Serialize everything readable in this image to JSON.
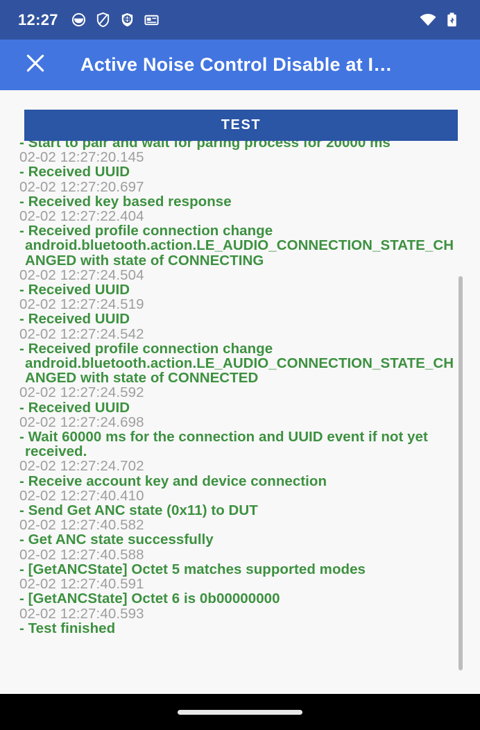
{
  "status_bar": {
    "time": "12:27",
    "left_icons": [
      "clock-outline-icon",
      "shield-slash-icon",
      "shield-globe-icon",
      "card-icon"
    ],
    "right_icons": [
      "wifi-icon",
      "battery-icon"
    ],
    "background_color": "#31539f"
  },
  "app_bar": {
    "close_icon": "close-icon",
    "title": "Active Noise Control Disable at I…",
    "background_color": "#4275e0"
  },
  "toolbar": {
    "test_label": "TEST",
    "test_color": "#2b55a5"
  },
  "colors": {
    "log_message": "#3d9140",
    "log_timestamp": "#9e9e9e",
    "content_background": "#f8f8f8",
    "scrollbar": "#bdbdbd"
  },
  "log": {
    "entries": [
      {
        "time": "",
        "message": "- Start to pair and wait for paring process for 20000 ms"
      },
      {
        "time": "02-02 12:27:20.145",
        "message": "- Received UUID"
      },
      {
        "time": "02-02 12:27:20.697",
        "message": "- Received key based response"
      },
      {
        "time": "02-02 12:27:22.404",
        "message": "- Received profile connection change android.bluetooth.action.LE_AUDIO_CONNECTION_STATE_CHANGED with state of CONNECTING"
      },
      {
        "time": "02-02 12:27:24.504",
        "message": "- Received UUID"
      },
      {
        "time": "02-02 12:27:24.519",
        "message": "- Received UUID"
      },
      {
        "time": "02-02 12:27:24.542",
        "message": "- Received profile connection change android.bluetooth.action.LE_AUDIO_CONNECTION_STATE_CHANGED with state of CONNECTED"
      },
      {
        "time": "02-02 12:27:24.592",
        "message": "- Received UUID"
      },
      {
        "time": "02-02 12:27:24.698",
        "message": "- Wait 60000 ms for the connection and UUID event if not yet received."
      },
      {
        "time": "02-02 12:27:24.702",
        "message": "- Receive account key and device connection"
      },
      {
        "time": "02-02 12:27:40.410",
        "message": "- Send Get ANC state (0x11) to DUT"
      },
      {
        "time": "02-02 12:27:40.582",
        "message": "- Get ANC state successfully"
      },
      {
        "time": "02-02 12:27:40.588",
        "message": "- [GetANCState] Octet 5 matches supported modes"
      },
      {
        "time": "02-02 12:27:40.591",
        "message": "- [GetANCState] Octet 6 is 0b00000000"
      },
      {
        "time": "02-02 12:27:40.593",
        "message": "- Test finished"
      }
    ]
  },
  "nav_bar": {
    "handle": "home-gesture-handle"
  }
}
